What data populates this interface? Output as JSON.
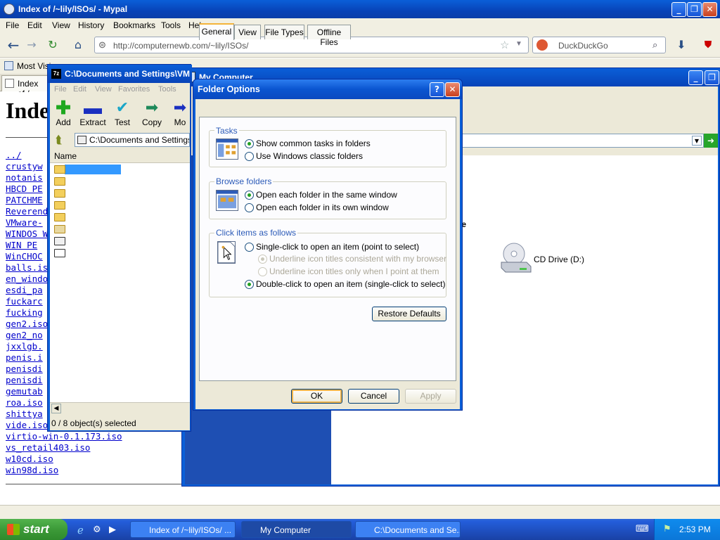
{
  "browser": {
    "title": "Index of /~lily/ISOs/ - Mypal",
    "menu": [
      "File",
      "Edit",
      "View",
      "History",
      "Bookmarks",
      "Tools",
      "Help"
    ],
    "url": "http://computernewb.com/~lily/ISOs/",
    "search_placeholder": "DuckDuckGo",
    "bookmark": "Most Visi",
    "tab": "Index of /",
    "heading": "Inde",
    "files": [
      "../",
      "crustyw",
      "notanis",
      "HBCD PE",
      "PATCHME",
      "Reverend",
      "VMware-",
      "WINDOS W",
      "WIN PE",
      "WinCHOC",
      "balls.is",
      "en_windo",
      "esdi_pa",
      "fuckarc",
      "fucking",
      "gen2.iso",
      "gen2_no",
      "jxxlgb.",
      "penis.i",
      "penisdi",
      "penisdi",
      "gemutab",
      "roa.iso",
      "shittya",
      "vide.iso",
      "virtio-win-0.1.173.iso",
      "vs_retail403.iso",
      "w10cd.iso",
      "win98d.iso"
    ]
  },
  "mycomputer": {
    "title": "My Computer",
    "section": "ge",
    "drive": "CD Drive (D:)"
  },
  "sevenzip": {
    "title": "C:\\Documents and Settings\\VM",
    "menu": [
      "File",
      "Edit",
      "View",
      "Favorites",
      "Tools"
    ],
    "toolbar": [
      "Add",
      "Extract",
      "Test",
      "Copy",
      "Mo"
    ],
    "path": "C:\\Documents and Settings",
    "column": "Name",
    "status": "0 / 8 object(s) selected"
  },
  "dialog": {
    "title": "Folder Options",
    "tabs": [
      "General",
      "View",
      "File Types",
      "Offline Files"
    ],
    "tasks": {
      "title": "Tasks",
      "options": [
        "Show common tasks in folders",
        "Use Windows classic folders"
      ],
      "selected": 0
    },
    "browse": {
      "title": "Browse folders",
      "options": [
        "Open each folder in the same window",
        "Open each folder in its own window"
      ],
      "selected": 0
    },
    "click": {
      "title": "Click items as follows",
      "single": "Single-click to open an item (point to select)",
      "sub1": "Underline icon titles consistent with my browser",
      "sub2": "Underline icon titles only when I point at them",
      "double": "Double-click to open an item (single-click to select)"
    },
    "restore": "Restore Defaults",
    "ok": "OK",
    "cancel": "Cancel",
    "apply": "Apply"
  },
  "taskbar": {
    "start": "start",
    "tasks": [
      "Index of /~lily/ISOs/ ...",
      "My Computer",
      "C:\\Documents and Se..."
    ],
    "clock": "2:53 PM"
  },
  "colors": {
    "xp_blue": "#0a5fd8",
    "start_green": "#3c9a38",
    "link": "#0000cc",
    "dialog_bg": "#ece9d8"
  }
}
